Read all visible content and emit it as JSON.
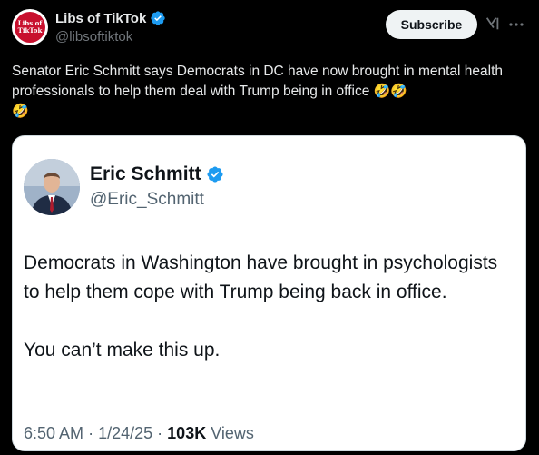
{
  "post": {
    "author": {
      "display_name": "Libs of TikTok",
      "handle": "@libsoftiktok",
      "avatar_text_line1": "Libs of",
      "avatar_text_line2": "TikTok"
    },
    "subscribe_label": "Subscribe",
    "text": "Senator Eric Schmitt says Democrats in DC have now brought in mental health professionals to help them deal with Trump being in office",
    "emojis": [
      "🤣",
      "🤣",
      "🤣"
    ]
  },
  "quoted": {
    "display_name": "Eric Schmitt",
    "handle": "@Eric_Schmitt",
    "paragraph1": "Democrats in Washington have brought in psychologists to help them cope with Trump being back in office.",
    "paragraph2": "You can’t make this up.",
    "time": "6:50 AM",
    "date": "1/24/25",
    "views_count": "103K",
    "views_label": "Views",
    "separator": "·"
  },
  "colors": {
    "background": "#000000",
    "verified_blue": "#1d9bf0",
    "subscribe_bg": "#eff3f4"
  },
  "icons": {
    "verified": "verified-badge-icon",
    "grok": "grok-icon",
    "more": "more-options-icon"
  }
}
